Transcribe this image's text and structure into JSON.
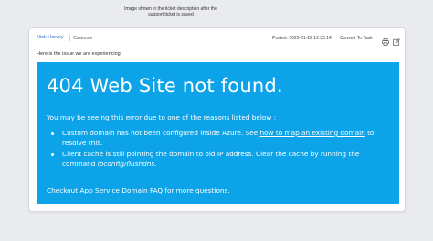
{
  "annotation": {
    "text": "Image shown in the ticket description after the support ticket is saved"
  },
  "header": {
    "agent_name": "Nick Harvey",
    "agent_role": "Customer",
    "posted": "Posted: 2025-01-22 12:33:14",
    "convert_label": "Convert To Task",
    "print_icon": "printer-icon",
    "edit_icon": "edit-icon"
  },
  "body": {
    "intro": "Here is the issue we are experiencing:"
  },
  "error_image": {
    "background": "#0ca3e8",
    "title": "404 Web Site not found.",
    "reasons_intro": "You may be seeing this error due to one of the reasons listed below :",
    "item1_prefix": "Custom domain has not been configured inside Azure. See ",
    "item1_link": "how to map an existing domain",
    "item1_suffix": " to",
    "item1_line2": "resolve this.",
    "item2_line1": "Client cache is still pointing the domain to old IP address. Clear the cache by running the",
    "item2_prefix": "command ",
    "item2_command": "ipconfig/flushdns",
    "item2_suffix": ".",
    "checkout_prefix": "Checkout ",
    "checkout_link": "App Service Domain FAQ",
    "checkout_suffix": " for more questions."
  }
}
